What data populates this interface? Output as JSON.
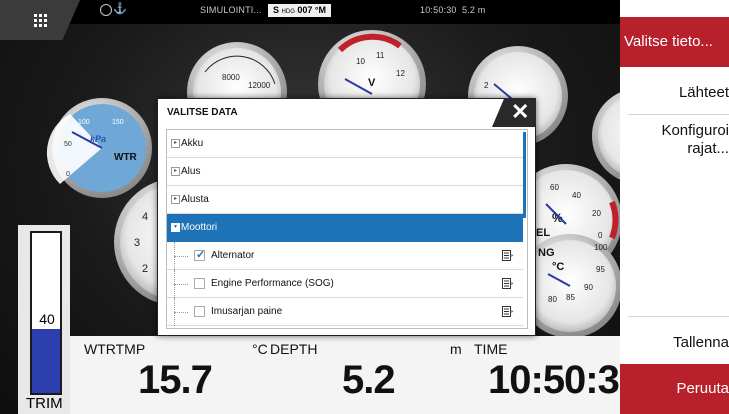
{
  "status_bar": {
    "sim_label": "SIMULOINTI...",
    "hdg_prefix": "S",
    "hdg_label": "HDG",
    "hdg_value": "007 °M",
    "time": "10:50:30",
    "depth": "5.2 m",
    "anchor_icon": "anchor-icon",
    "globe_icon": "globe-icon"
  },
  "gauges": {
    "rpm_tick_low": "8000",
    "rpm_tick_high": "12000",
    "volt_tick_a": "10",
    "volt_tick_b": "11",
    "volt_tick_c": "12",
    "volt_unit": "V",
    "wtr_unit": "kPa",
    "wtr_label": "WTR",
    "wtr_tick_100": "100",
    "wtr_tick_150": "150",
    "wtr_tick_50": "50",
    "wtr_tick_0": "0",
    "small_tick": "2",
    "left_tick_4": "4",
    "left_tick_3": "3",
    "left_tick_2": "2",
    "fuel_unit": "%",
    "fuel_tick_60": "60",
    "fuel_tick_40": "40",
    "fuel_tick_20": "20",
    "fuel_tick_0": "0",
    "fuel_label": "EL",
    "temp_label": "NG",
    "temp_unit": "°C",
    "temp_tick_100": "100",
    "temp_tick_95": "95",
    "temp_tick_90": "90",
    "temp_tick_85": "85",
    "temp_tick_80": "80"
  },
  "trim": {
    "value": "40",
    "level_percent": 40,
    "label": "TRIM"
  },
  "data_bar": {
    "items": [
      {
        "label": "WTRTMP",
        "unit": "°C",
        "value": "15.7"
      },
      {
        "label": "DEPTH",
        "unit": "m",
        "value": "5.2"
      },
      {
        "label": "TIME",
        "unit": "",
        "value": "10:50:3"
      }
    ]
  },
  "right_panel": {
    "title": "Valitse tieto...",
    "items": [
      "Lähteet",
      "Konfiguroi rajat..."
    ],
    "save": "Tallenna",
    "cancel": "Peruuta"
  },
  "dialog": {
    "title": "VALITSE DATA",
    "close_icon": "close-icon",
    "rows": [
      {
        "label": "Akku",
        "type": "category",
        "expanded": false
      },
      {
        "label": "Alus",
        "type": "category",
        "expanded": false
      },
      {
        "label": "Alusta",
        "type": "category",
        "expanded": false
      },
      {
        "label": "Moottori",
        "type": "category",
        "expanded": true,
        "selected": true
      },
      {
        "label": "Alternator",
        "type": "item",
        "checked": true
      },
      {
        "label": "Engine Performance (SOG)",
        "type": "item",
        "checked": false
      },
      {
        "label": "Imusarjan paine",
        "type": "item",
        "checked": false
      }
    ]
  },
  "colors": {
    "accent_red": "#b8212b",
    "selection_blue": "#1e72b8",
    "trim_fill": "#2d3fae"
  }
}
